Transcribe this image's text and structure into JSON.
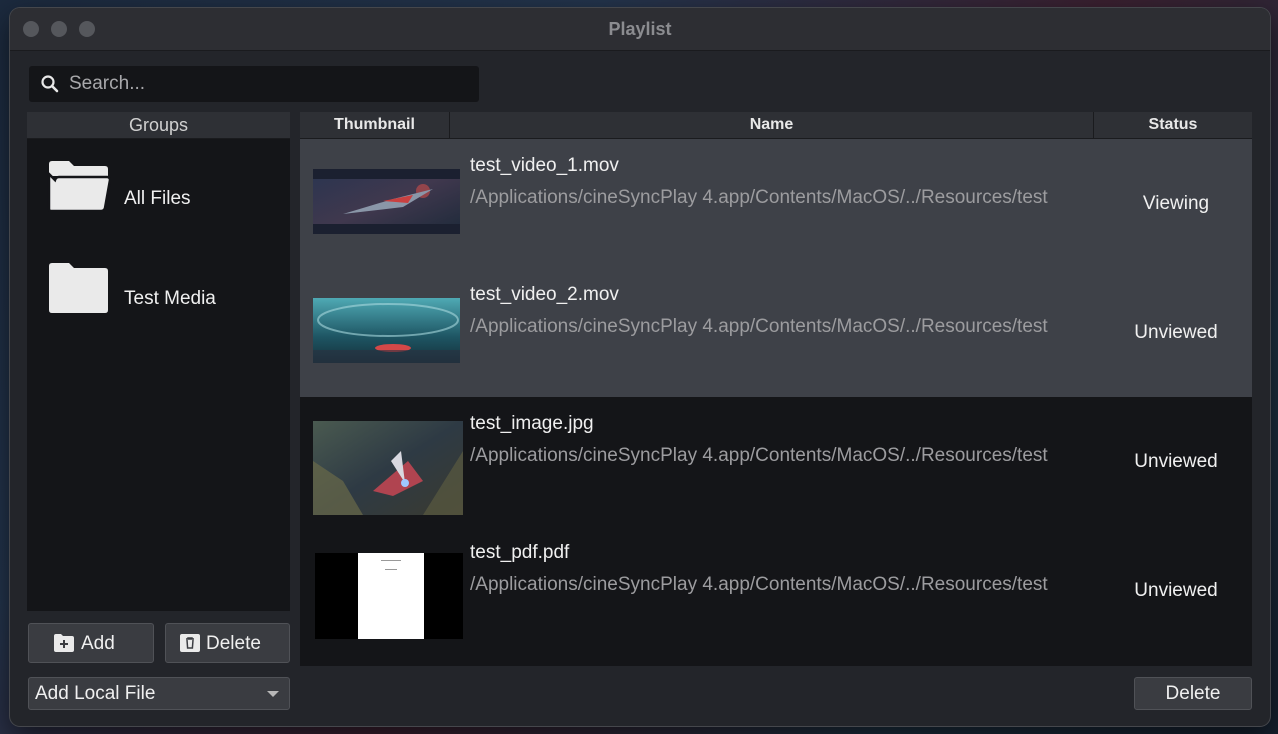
{
  "window": {
    "title": "Playlist"
  },
  "search": {
    "placeholder": "Search..."
  },
  "groups": {
    "header": "Groups",
    "items": [
      {
        "label": "All Files",
        "icon": "open-folder-icon"
      },
      {
        "label": "Test Media",
        "icon": "folder-icon"
      }
    ],
    "add_label": "Add",
    "delete_label": "Delete"
  },
  "add_source": {
    "selected": "Add Local File"
  },
  "table": {
    "columns": [
      "Thumbnail",
      "Name",
      "Status"
    ],
    "rows": [
      {
        "name": "test_video_1.mov",
        "path": "/Applications/cineSyncPlay 4.app/Contents/MacOS/../Resources/test",
        "status": "Viewing"
      },
      {
        "name": "test_video_2.mov",
        "path": "/Applications/cineSyncPlay 4.app/Contents/MacOS/../Resources/test",
        "status": "Unviewed"
      },
      {
        "name": "test_image.jpg",
        "path": "/Applications/cineSyncPlay 4.app/Contents/MacOS/../Resources/test",
        "status": "Unviewed"
      },
      {
        "name": "test_pdf.pdf",
        "path": "/Applications/cineSyncPlay 4.app/Contents/MacOS/../Resources/test",
        "status": "Unviewed"
      }
    ]
  },
  "footer": {
    "delete_label": "Delete"
  },
  "colors": {
    "selected_row": "#3e4148",
    "panel": "#141518",
    "window": "#23252a"
  }
}
